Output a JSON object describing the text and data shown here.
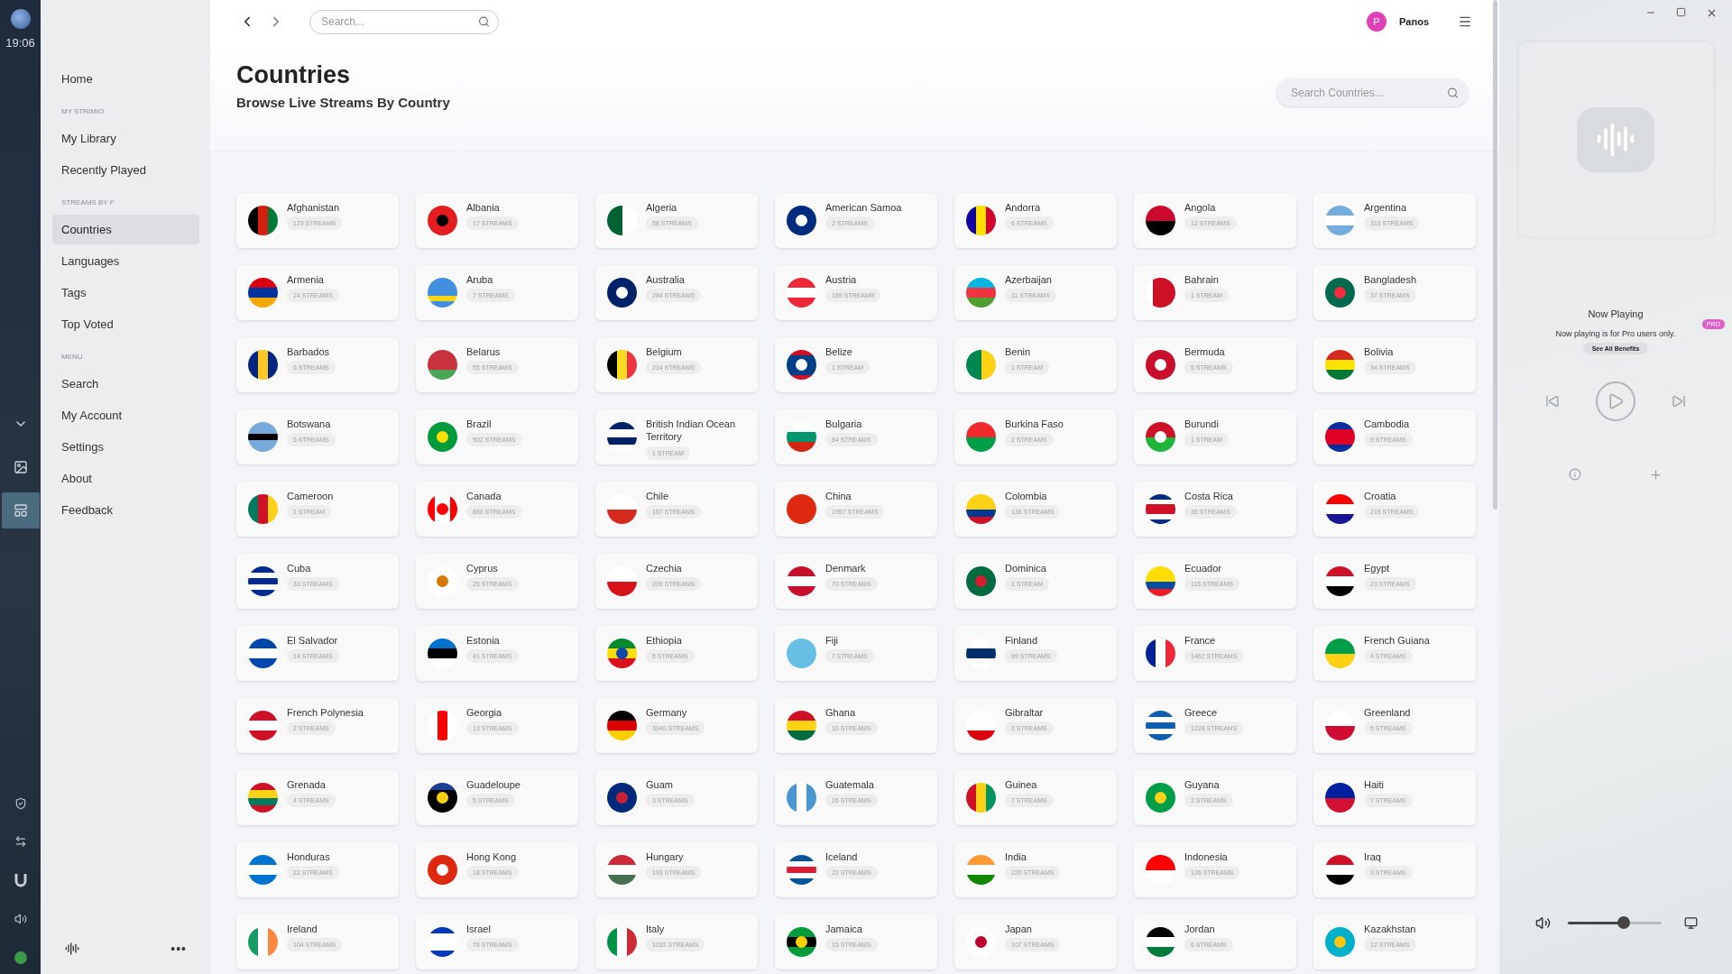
{
  "rail": {
    "time": "19:06",
    "apps": [
      {
        "selected": false
      },
      {
        "selected": false
      },
      {
        "selected": true
      }
    ]
  },
  "sidebar": {
    "items": [
      {
        "kind": "link",
        "label": "Home",
        "selected": false
      },
      {
        "kind": "heading",
        "label": "MY STRIMIO"
      },
      {
        "kind": "link",
        "label": "My Library",
        "selected": false
      },
      {
        "kind": "link",
        "label": "Recently Played",
        "selected": false
      },
      {
        "kind": "heading",
        "label": "STREAMS BY F"
      },
      {
        "kind": "link",
        "label": "Countries",
        "selected": true
      },
      {
        "kind": "link",
        "label": "Languages",
        "selected": false
      },
      {
        "kind": "link",
        "label": "Tags",
        "selected": false
      },
      {
        "kind": "link",
        "label": "Top Voted",
        "selected": false
      },
      {
        "kind": "heading",
        "label": "MENU"
      },
      {
        "kind": "link",
        "label": "Search",
        "selected": false
      },
      {
        "kind": "link",
        "label": "My Account",
        "selected": false
      },
      {
        "kind": "link",
        "label": "Settings",
        "selected": false
      },
      {
        "kind": "link",
        "label": "About",
        "selected": false
      },
      {
        "kind": "link",
        "label": "Feedback",
        "selected": false
      }
    ],
    "more": "•••"
  },
  "topbar": {
    "search": {
      "placeholder": "Search..."
    },
    "user": {
      "initial": "P",
      "name": "Panos"
    }
  },
  "header": {
    "title": "Countries",
    "subtitle": "Browse Live Streams By Country",
    "search": {
      "placeholder": "Search Countries..."
    }
  },
  "countries": [
    {
      "name": "Afghanistan",
      "streams": "123 STREAMS"
    },
    {
      "name": "Albania",
      "streams": "17 STREAMS"
    },
    {
      "name": "Algeria",
      "streams": "58 STREAMS"
    },
    {
      "name": "American Samoa",
      "streams": "2 STREAMS"
    },
    {
      "name": "Andorra",
      "streams": "6 STREAMS"
    },
    {
      "name": "Angola",
      "streams": "12 STREAMS"
    },
    {
      "name": "Argentina",
      "streams": "319 STREAMS"
    },
    {
      "name": "Armenia",
      "streams": "24 STREAMS"
    },
    {
      "name": "Aruba",
      "streams": "7 STREAMS"
    },
    {
      "name": "Australia",
      "streams": "284 STREAMS"
    },
    {
      "name": "Austria",
      "streams": "189 STREAMS"
    },
    {
      "name": "Azerbaijan",
      "streams": "11 STREAMS"
    },
    {
      "name": "Bahrain",
      "streams": "1 STREAM"
    },
    {
      "name": "Bangladesh",
      "streams": "37 STREAMS"
    },
    {
      "name": "Barbados",
      "streams": "6 STREAMS"
    },
    {
      "name": "Belarus",
      "streams": "55 STREAMS"
    },
    {
      "name": "Belgium",
      "streams": "214 STREAMS"
    },
    {
      "name": "Belize",
      "streams": "1 STREAM"
    },
    {
      "name": "Benin",
      "streams": "1 STREAM"
    },
    {
      "name": "Bermuda",
      "streams": "5 STREAMS"
    },
    {
      "name": "Bolivia",
      "streams": "34 STREAMS"
    },
    {
      "name": "Botswana",
      "streams": "5 STREAMS"
    },
    {
      "name": "Brazil",
      "streams": "502 STREAMS"
    },
    {
      "name": "British Indian Ocean Territory",
      "streams": "1 STREAM"
    },
    {
      "name": "Bulgaria",
      "streams": "84 STREAMS"
    },
    {
      "name": "Burkina Faso",
      "streams": "2 STREAMS"
    },
    {
      "name": "Burundi",
      "streams": "1 STREAM"
    },
    {
      "name": "Cambodia",
      "streams": "9 STREAMS"
    },
    {
      "name": "Cameroon",
      "streams": "1 STREAM"
    },
    {
      "name": "Canada",
      "streams": "860 STREAMS"
    },
    {
      "name": "Chile",
      "streams": "167 STREAMS"
    },
    {
      "name": "China",
      "streams": "1957 STREAMS"
    },
    {
      "name": "Colombia",
      "streams": "138 STREAMS"
    },
    {
      "name": "Costa Rica",
      "streams": "35 STREAMS"
    },
    {
      "name": "Croatia",
      "streams": "219 STREAMS"
    },
    {
      "name": "Cuba",
      "streams": "33 STREAMS"
    },
    {
      "name": "Cyprus",
      "streams": "25 STREAMS"
    },
    {
      "name": "Czechia",
      "streams": "209 STREAMS"
    },
    {
      "name": "Denmark",
      "streams": "70 STREAMS"
    },
    {
      "name": "Dominica",
      "streams": "1 STREAM"
    },
    {
      "name": "Ecuador",
      "streams": "115 STREAMS"
    },
    {
      "name": "Egypt",
      "streams": "23 STREAMS"
    },
    {
      "name": "El Salvador",
      "streams": "14 STREAMS"
    },
    {
      "name": "Estonia",
      "streams": "41 STREAMS"
    },
    {
      "name": "Ethiopia",
      "streams": "5 STREAMS"
    },
    {
      "name": "Fiji",
      "streams": "7 STREAMS"
    },
    {
      "name": "Finland",
      "streams": "99 STREAMS"
    },
    {
      "name": "France",
      "streams": "1462 STREAMS"
    },
    {
      "name": "French Guiana",
      "streams": "4 STREAMS"
    },
    {
      "name": "French Polynesia",
      "streams": "2 STREAMS"
    },
    {
      "name": "Georgia",
      "streams": "13 STREAMS"
    },
    {
      "name": "Germany",
      "streams": "3040 STREAMS"
    },
    {
      "name": "Ghana",
      "streams": "10 STREAMS"
    },
    {
      "name": "Gibraltar",
      "streams": "2 STREAMS"
    },
    {
      "name": "Greece",
      "streams": "1228 STREAMS"
    },
    {
      "name": "Greenland",
      "streams": "5 STREAMS"
    },
    {
      "name": "Grenada",
      "streams": "4 STREAMS"
    },
    {
      "name": "Guadeloupe",
      "streams": "5 STREAMS"
    },
    {
      "name": "Guam",
      "streams": "3 STREAMS"
    },
    {
      "name": "Guatemala",
      "streams": "26 STREAMS"
    },
    {
      "name": "Guinea",
      "streams": "7 STREAMS"
    },
    {
      "name": "Guyana",
      "streams": "2 STREAMS"
    },
    {
      "name": "Haiti",
      "streams": "7 STREAMS"
    },
    {
      "name": "Honduras",
      "streams": "22 STREAMS"
    },
    {
      "name": "Hong Kong",
      "streams": "18 STREAMS"
    },
    {
      "name": "Hungary",
      "streams": "193 STREAMS"
    },
    {
      "name": "Iceland",
      "streams": "22 STREAMS"
    },
    {
      "name": "India",
      "streams": "220 STREAMS"
    },
    {
      "name": "Indonesia",
      "streams": "126 STREAMS"
    },
    {
      "name": "Iraq",
      "streams": "3 STREAMS"
    },
    {
      "name": "Ireland",
      "streams": "104 STREAMS"
    },
    {
      "name": "Israel",
      "streams": "76 STREAMS"
    },
    {
      "name": "Italy",
      "streams": "1032 STREAMS"
    },
    {
      "name": "Jamaica",
      "streams": "15 STREAMS"
    },
    {
      "name": "Japan",
      "streams": "107 STREAMS"
    },
    {
      "name": "Jordan",
      "streams": "6 STREAMS"
    },
    {
      "name": "Kazakhstan",
      "streams": "12 STREAMS"
    }
  ],
  "player": {
    "heading": "Now Playing",
    "badge": "PRO",
    "notice": "Now playing is for Pro users only.",
    "benefits_button": "See All Benefits",
    "volume": {
      "level": 0.6
    }
  }
}
